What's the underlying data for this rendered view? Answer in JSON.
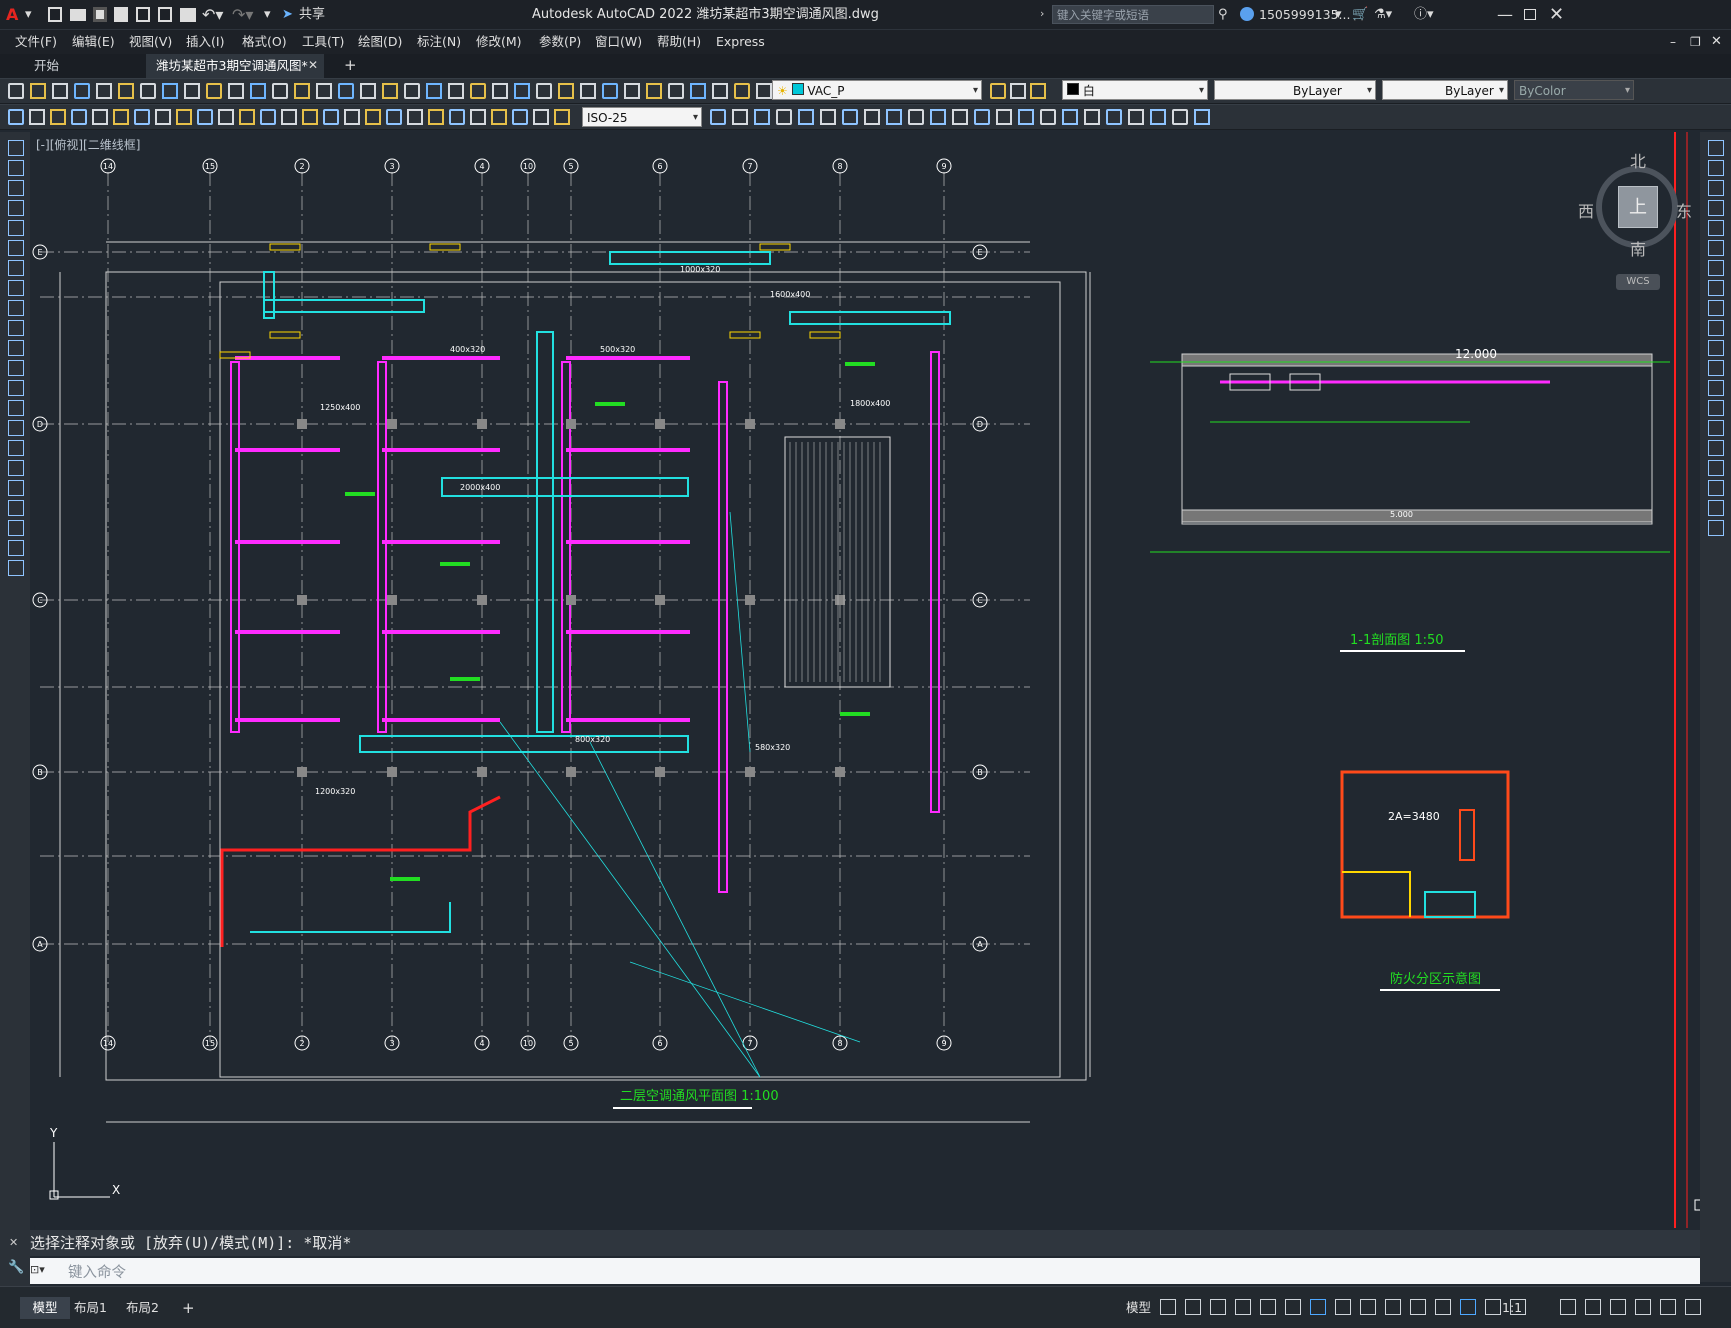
{
  "window": {
    "title": "Autodesk AutoCAD 2022    潍坊某超市3期空调通风图.dwg",
    "share_label": "共享",
    "search_placeholder": "键入关键字或短语",
    "user": "1505999135..."
  },
  "menu": [
    "文件(F)",
    "编辑(E)",
    "视图(V)",
    "插入(I)",
    "格式(O)",
    "工具(T)",
    "绘图(D)",
    "标注(N)",
    "修改(M)",
    "参数(P)",
    "窗口(W)",
    "帮助(H)",
    "Express"
  ],
  "tabs": [
    {
      "label": "开始",
      "active": false
    },
    {
      "label": "潍坊某超市3期空调通风图*",
      "active": true
    }
  ],
  "layer_props": {
    "layer": "VAC_P",
    "color": "白",
    "linetype": "ByLayer",
    "lineweight": "ByLayer",
    "plotstyle": "ByColor",
    "dimstyle": "ISO-25"
  },
  "viewport_label": "[-][俯视][二维线框]",
  "viewcube": {
    "north": "北",
    "south": "南",
    "east": "东",
    "west": "西",
    "top": "上",
    "wcs": "WCS"
  },
  "drawing": {
    "plan_title": "二层空调通风平面图  1:100",
    "section_title": "1-1剖面图 1:50",
    "fire_title": "防火分区示意图",
    "section_dim": "12.000",
    "section_level": "5.000",
    "fire_area_text": "2A=3480",
    "grid_top": [
      "14",
      "15",
      "2",
      "3",
      "4",
      "10",
      "5",
      "6",
      "7",
      "8",
      "9"
    ],
    "grid_left": [
      "E",
      "D",
      "C",
      "B",
      "A"
    ],
    "duct_labels": [
      "400x320",
      "500x320",
      "1250x400",
      "2000x400",
      "1000x320",
      "1600x400",
      "580x320",
      "800x320",
      "1800x400",
      "1200x320"
    ]
  },
  "command": {
    "history": "选择注释对象或 [放弃(U)/模式(M)]: *取消*",
    "placeholder": "键入命令"
  },
  "layouts": [
    "模型",
    "布局1",
    "布局2"
  ],
  "status": {
    "model": "模型",
    "scale": "1:1"
  },
  "colors": {
    "bg": "#212830",
    "duct_magenta": "#ff2bff",
    "duct_cyan": "#22e0e0",
    "wall": "#d8d8d8",
    "red": "#ff2020",
    "yellow": "#ffd700",
    "green": "#22dd22"
  }
}
